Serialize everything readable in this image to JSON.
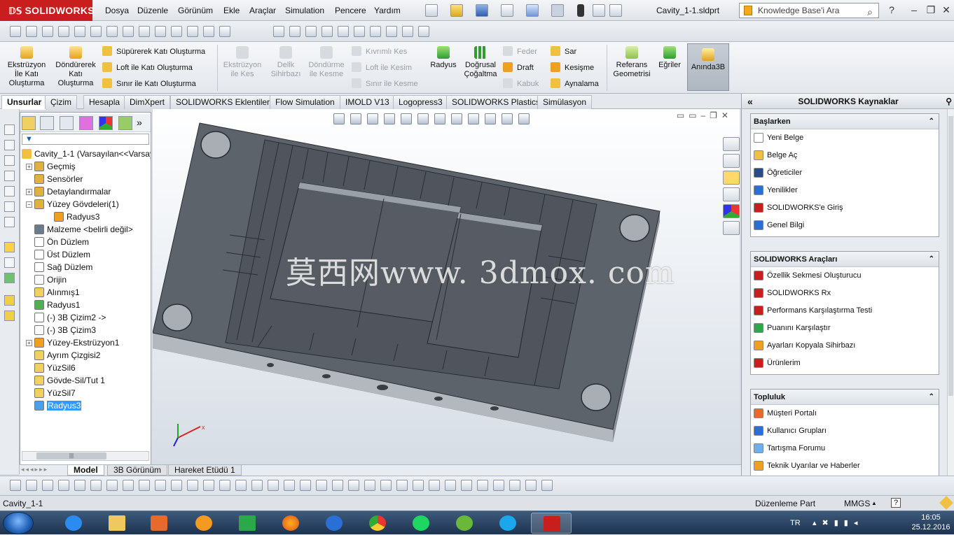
{
  "app": {
    "logo": "SOLIDWORKS",
    "doc_title": "Cavity_1-1.sldprt"
  },
  "menu": [
    "Dosya",
    "Düzenle",
    "Görünüm",
    "Ekle",
    "Araçlar",
    "Simulation",
    "Pencere",
    "Yardım"
  ],
  "search": {
    "placeholder": "Knowledge Base'i Ara"
  },
  "commands": {
    "big": [
      {
        "label": "Ekstrüzyon\nİle Katı\nOluşturma"
      },
      {
        "label": "Döndürerek\nKatı\nOluşturma"
      }
    ],
    "col1": [
      "Süpürerek Katı Oluşturma",
      "Loft ile Katı Oluşturma",
      "Sınır ile Katı Oluşturma"
    ],
    "cut_big": [
      "Ekstrüzyon\nile Kes",
      "Delik\nSihirbazı",
      "Döndürme\nile Kesme"
    ],
    "col2": [
      "Kıvrımlı Kes",
      "Loft ile Kesim",
      "Sınır ile Kesme"
    ],
    "radius": "Radyus",
    "linear": "Doğrusal\nÇoğaltma",
    "col3": [
      "Feder",
      "Draft",
      "Kabuk"
    ],
    "col4": [
      "Sar",
      "Kesişme",
      "Aynalama"
    ],
    "ref_geo": "Referans\nGeometrisi",
    "curves": "Eğriler",
    "instant3d": "Anında3B"
  },
  "tabs": [
    "Unsurlar",
    "Çizim",
    "Hesapla",
    "DimXpert",
    "SOLIDWORKS Eklentileri",
    "Flow Simulation",
    "IMOLD V13",
    "Logopress3",
    "SOLIDWORKS Plastics",
    "Simülasyon"
  ],
  "tree": {
    "root": "Cavity_1-1  (Varsayılan<<Varsay",
    "items": [
      {
        "label": "Geçmiş",
        "expand": true,
        "color": "#e0b040"
      },
      {
        "label": "Sensörler",
        "expand": false,
        "color": "#e0b040"
      },
      {
        "label": "Detaylandırmalar",
        "expand": true,
        "color": "#e0b040"
      },
      {
        "label": "Yüzey Gövdeleri(1)",
        "expand": "open",
        "color": "#e0b040"
      },
      {
        "label": "Radyus3",
        "expand": false,
        "color": "#f0a020",
        "indent": true
      },
      {
        "label": "Malzeme <belirli değil>",
        "expand": false,
        "color": "#6b7b8c"
      },
      {
        "label": "Ön Düzlem",
        "expand": false,
        "color": "#ffffff"
      },
      {
        "label": "Üst Düzlem",
        "expand": false,
        "color": "#ffffff"
      },
      {
        "label": "Sağ Düzlem",
        "expand": false,
        "color": "#ffffff"
      },
      {
        "label": "Orijin",
        "expand": false,
        "color": "#ffffff"
      },
      {
        "label": "Alınmış1",
        "expand": false,
        "color": "#f0d060"
      },
      {
        "label": "Radyus1",
        "expand": false,
        "color": "#50b050"
      },
      {
        "label": "(-) 3B Çizim2 ->",
        "expand": false,
        "color": "#ffffff"
      },
      {
        "label": "(-) 3B Çizim3",
        "expand": false,
        "color": "#ffffff"
      },
      {
        "label": "Yüzey-Ekstrüzyon1",
        "expand": true,
        "color": "#f0a020"
      },
      {
        "label": "Ayrım Çizgisi2",
        "expand": false,
        "color": "#f0d060"
      },
      {
        "label": "YüzSil6",
        "expand": false,
        "color": "#f0d060"
      },
      {
        "label": "Gövde-Sil/Tut 1",
        "expand": false,
        "color": "#f0d060"
      },
      {
        "label": "YüzSil7",
        "expand": false,
        "color": "#f0d060"
      },
      {
        "label": "Radyus3",
        "expand": false,
        "color": "#4aa0e8",
        "selected": true
      }
    ]
  },
  "watermark": "莫西网www. 3dmox. com",
  "bottom_tabs": [
    "Model",
    "3B Görünüm",
    "Hareket Etüdü 1"
  ],
  "resources": {
    "title": "SOLIDWORKS Kaynaklar",
    "groups": [
      {
        "title": "Başlarken",
        "items": [
          "Yeni Belge",
          "Belge Aç",
          "Öğreticiler",
          "Yenilikler",
          "SOLIDWORKS'e Giriş",
          "Genel Bilgi"
        ]
      },
      {
        "title": "SOLIDWORKS Araçları",
        "items": [
          "Özellik Sekmesi Oluşturucu",
          "SOLIDWORKS Rx",
          "Performans Karşılaştırma Testi",
          "Puanını Karşılaştır",
          "Ayarları Kopyala Sihirbazı",
          "Ürünlerim"
        ]
      },
      {
        "title": "Topluluk",
        "items": [
          "Müşteri Portalı",
          "Kullanıcı Grupları",
          "Tartışma Forumu",
          "Teknik Uyarılar ve Haberler"
        ]
      }
    ]
  },
  "status": {
    "left": "Cavity_1-1",
    "mode": "Düzenleme Part",
    "units": "MMGS",
    "help": "?"
  },
  "taskbar": {
    "lang": "TR",
    "time": "16:05",
    "date": "25.12.2016"
  },
  "colors": {
    "brand": "#c81e1e",
    "part": "#5b6068",
    "selection": "#3399ff"
  }
}
